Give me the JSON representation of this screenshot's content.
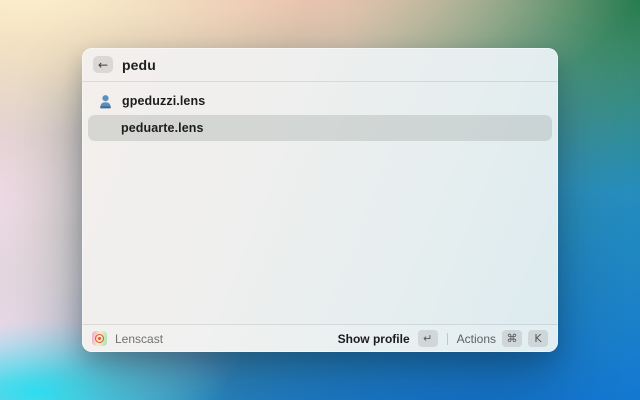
{
  "window": {
    "search": {
      "value": "pedu"
    },
    "results": [
      {
        "label": "gpeduzzi.lens",
        "icon": "person-avatar-blue",
        "selected": false
      },
      {
        "label": "peduarte.lens",
        "icon": "photo-avatar",
        "selected": true
      }
    ],
    "footer": {
      "app_name": "Lenscast",
      "primary_action": {
        "label": "Show profile",
        "key": "↵"
      },
      "secondary_action": {
        "label": "Actions",
        "keys": [
          "⌘",
          "K"
        ]
      }
    }
  },
  "icons": {
    "back_arrow": "←"
  },
  "colors": {
    "selection": "rgba(150,155,152,0.30)",
    "logo_ring": "#e4512e",
    "bg_top_left": "#fdf6cf",
    "bg_top_mid": "#f6c3ae",
    "bg_top_right": "#15713f",
    "bg_bottom": "#0d6fd4"
  }
}
